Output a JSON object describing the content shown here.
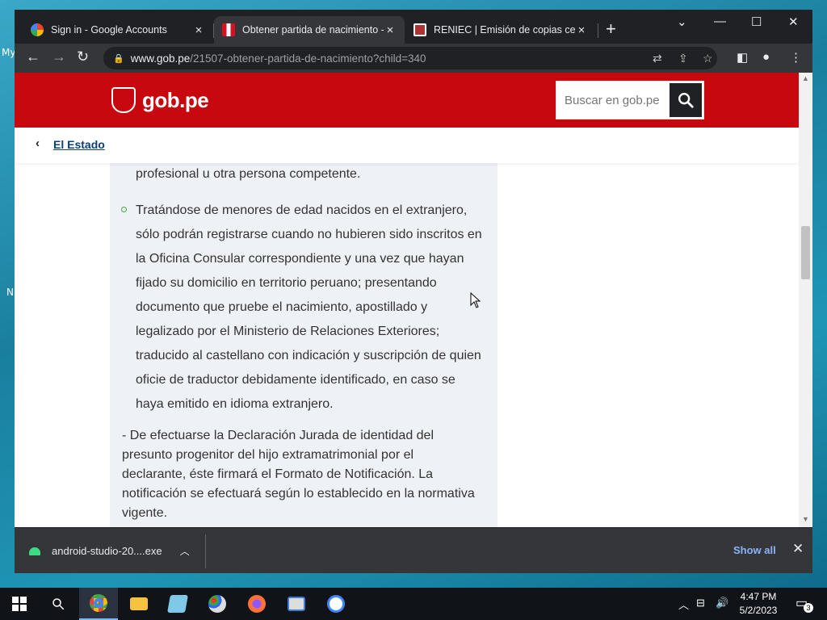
{
  "desktop": {
    "label_top": "My",
    "label_mid": "N"
  },
  "tabs": [
    {
      "title": "Sign in - Google Accounts",
      "close": "×"
    },
    {
      "title": "Obtener partida de nacimiento -",
      "close": "×"
    },
    {
      "title": "RENIEC | Emisión de copias certi",
      "close": "×"
    }
  ],
  "new_tab": "+",
  "window_controls": {
    "dropdown": "⌄",
    "minimize": "—",
    "maximize": "☐",
    "close": "✕"
  },
  "toolbar": {
    "back": "←",
    "forward": "→",
    "reload": "↻"
  },
  "url": {
    "domain": "www.gob.pe",
    "path": "/21507-obtener-partida-de-nacimiento?child=340"
  },
  "site": {
    "logo_text": "gob.pe",
    "search_placeholder": "Buscar en gob.pe",
    "breadcrumb": "El Estado",
    "fragment": "profesional u otra persona competente.",
    "bullet_text": "Tratándose de menores de edad nacidos en el extranjero, sólo podrán registrarse cuando no hubieren sido inscritos en la Oficina Consular correspondiente y una vez que hayan fijado su domicilio en territorio peruano; presentando documento que pruebe el nacimiento, apostillado y legalizado por el Ministerio de Relaciones Exteriores; traducido al castellano con indicación y suscripción de quien oficie de traductor debidamente identificado, en caso se haya emitido en idioma extranjero.",
    "paragraph": "- De efectuarse la Declaración Jurada de identidad del presunto progenitor del hijo extramatrimonial por el declarante, éste firmará el Formato de Notificación. La notificación se efectuará según lo establecido en la normativa vigente."
  },
  "download": {
    "filename": "android-studio-20....exe",
    "show_all": "Show all",
    "close": "✕"
  },
  "taskbar": {
    "time": "4:47 PM",
    "date": "5/2/2023",
    "notifications": "3"
  },
  "colors": {
    "gob_red": "#c7080f",
    "link_blue": "#0a3f73",
    "content_bg": "#eef1f6"
  }
}
